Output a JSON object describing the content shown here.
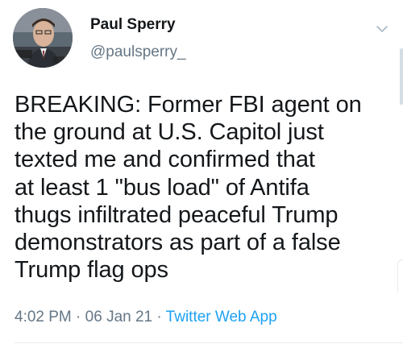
{
  "tweet": {
    "author": {
      "name": "Paul Sperry",
      "handle": "@paulsperry_"
    },
    "text_lines": [
      "BREAKING: Former FBI agent on",
      "the ground at U.S. Capitol just",
      "texted me and confirmed that",
      "at least 1 \"bus load\" of Antifa",
      "thugs infiltrated peaceful Trump",
      "demonstrators as part of a false",
      "Trump flag ops"
    ],
    "time": "4:02 PM",
    "separator": "·",
    "date": "06 Jan 21",
    "source": "Twitter Web App"
  },
  "icons": {
    "menu": "chevron-down-icon",
    "avatar": "avatar-photo"
  },
  "colors": {
    "name_text": "#14171a",
    "secondary_text": "#657786",
    "link": "#1da1f2",
    "divider": "#e6ecf0"
  }
}
